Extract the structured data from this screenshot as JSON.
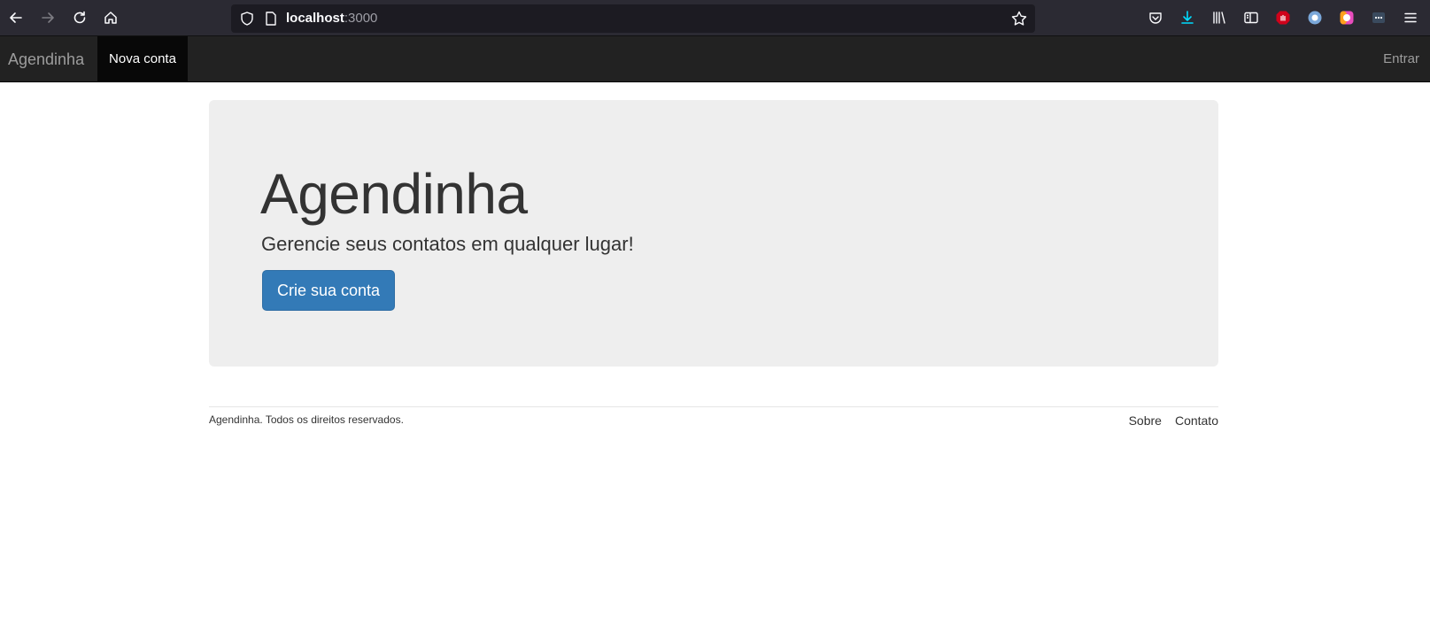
{
  "browser": {
    "url_host": "localhost",
    "url_port": ":3000"
  },
  "navbar": {
    "brand": "Agendinha",
    "active_item": "Nova conta",
    "right_item": "Entrar"
  },
  "jumbotron": {
    "title": "Agendinha",
    "lead": "Gerencie seus contatos em qualquer lugar!",
    "button_label": "Crie sua conta",
    "button_color": "#337ab7"
  },
  "footer": {
    "copyright": "Agendinha. Todos os direitos reservados.",
    "links": [
      "Sobre",
      "Contato"
    ]
  },
  "colors": {
    "navbar_bg": "#222222",
    "navbar_active_bg": "#080808",
    "jumbotron_bg": "#eeeeee"
  }
}
